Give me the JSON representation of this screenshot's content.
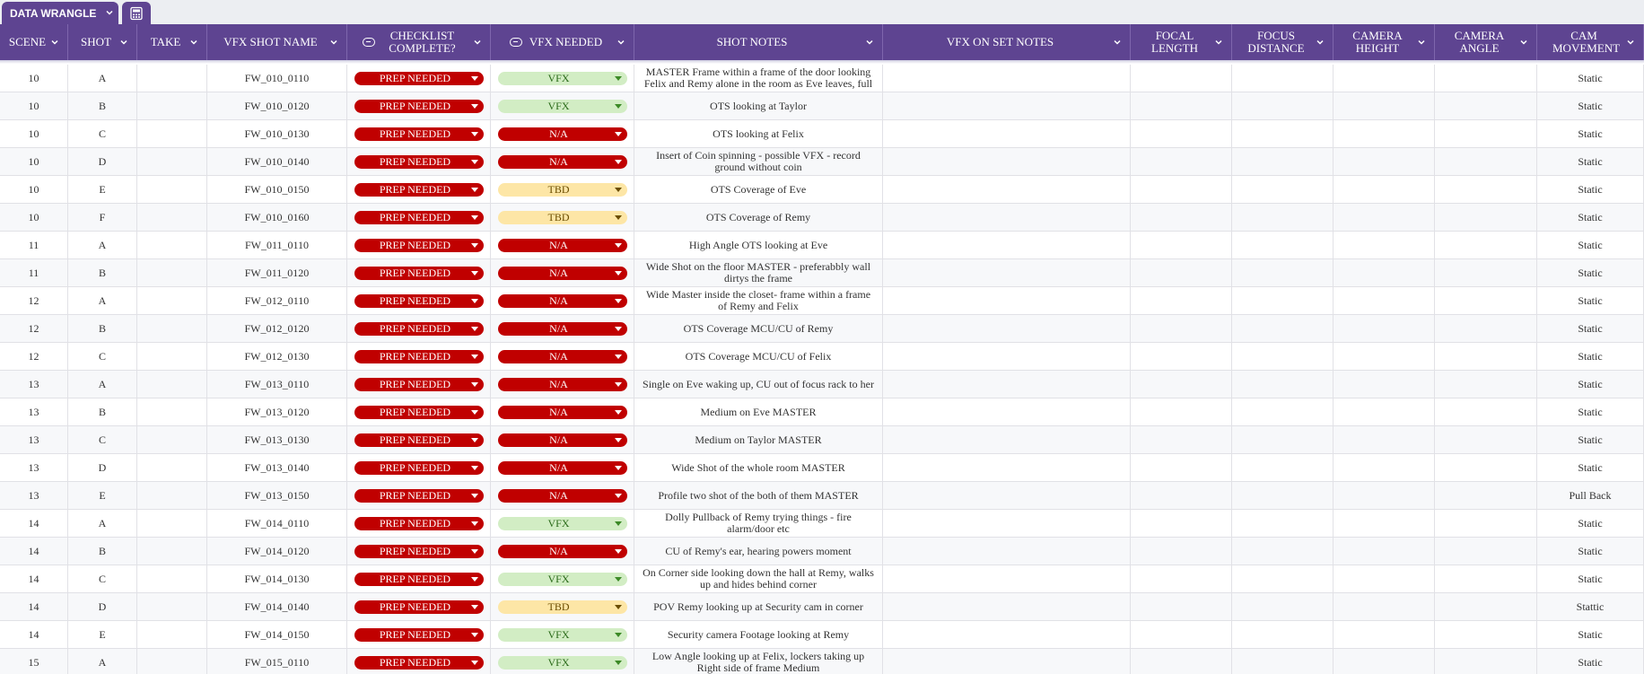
{
  "tabs": {
    "active_label": "DATA WRANGLE",
    "icon": "calculator-icon"
  },
  "colors": {
    "header_bg": "#5e4491",
    "prep_needed": "#c00000",
    "vfx": "#d2edc4",
    "na": "#c00000",
    "tbd": "#fde6a6"
  },
  "columns": {
    "scene": "SCENE",
    "shot": "SHOT",
    "take": "TAKE",
    "vfx_shot_name": "VFX SHOT NAME",
    "checklist_complete": "CHECKLIST COMPLETE?",
    "vfx_needed": "VFX NEEDED",
    "shot_notes": "SHOT NOTES",
    "vfx_on_set_notes": "VFX ON SET NOTES",
    "focal_length": "FOCAL LENGTH",
    "focus_distance": "FOCUS DISTANCE",
    "camera_height": "CAMERA HEIGHT",
    "camera_angle": "CAMERA ANGLE",
    "cam_movement": "CAM MOVEMENT"
  },
  "rows": [
    {
      "scene": "10",
      "shot": "A",
      "take": "",
      "name": "FW_010_0110",
      "checklist": "PREP NEEDED",
      "vfx": "VFX",
      "notes": "MASTER Frame within a frame of the door looking Felix and Remy alone in the room as Eve leaves, full",
      "onset": "",
      "focal": "",
      "fdist": "",
      "cheight": "",
      "cangle": "",
      "cam": "Static"
    },
    {
      "scene": "10",
      "shot": "B",
      "take": "",
      "name": "FW_010_0120",
      "checklist": "PREP NEEDED",
      "vfx": "VFX",
      "notes": "OTS looking at Taylor",
      "onset": "",
      "focal": "",
      "fdist": "",
      "cheight": "",
      "cangle": "",
      "cam": "Static"
    },
    {
      "scene": "10",
      "shot": "C",
      "take": "",
      "name": "FW_010_0130",
      "checklist": "PREP NEEDED",
      "vfx": "N/A",
      "notes": "OTS looking at Felix",
      "onset": "",
      "focal": "",
      "fdist": "",
      "cheight": "",
      "cangle": "",
      "cam": "Static"
    },
    {
      "scene": "10",
      "shot": "D",
      "take": "",
      "name": "FW_010_0140",
      "checklist": "PREP NEEDED",
      "vfx": "N/A",
      "notes": "Insert of Coin spinning - possible VFX - record ground without coin",
      "onset": "",
      "focal": "",
      "fdist": "",
      "cheight": "",
      "cangle": "",
      "cam": "Static"
    },
    {
      "scene": "10",
      "shot": "E",
      "take": "",
      "name": "FW_010_0150",
      "checklist": "PREP NEEDED",
      "vfx": "TBD",
      "notes": "OTS Coverage of Eve",
      "onset": "",
      "focal": "",
      "fdist": "",
      "cheight": "",
      "cangle": "",
      "cam": "Static"
    },
    {
      "scene": "10",
      "shot": "F",
      "take": "",
      "name": "FW_010_0160",
      "checklist": "PREP NEEDED",
      "vfx": "TBD",
      "notes": "OTS Coverage of Remy",
      "onset": "",
      "focal": "",
      "fdist": "",
      "cheight": "",
      "cangle": "",
      "cam": "Static"
    },
    {
      "scene": "11",
      "shot": "A",
      "take": "",
      "name": "FW_011_0110",
      "checklist": "PREP NEEDED",
      "vfx": "N/A",
      "notes": "High Angle OTS looking at Eve",
      "onset": "",
      "focal": "",
      "fdist": "",
      "cheight": "",
      "cangle": "",
      "cam": "Static"
    },
    {
      "scene": "11",
      "shot": "B",
      "take": "",
      "name": "FW_011_0120",
      "checklist": "PREP NEEDED",
      "vfx": "N/A",
      "notes": "Wide Shot on the floor MASTER - preferabbly wall dirtys the frame",
      "onset": "",
      "focal": "",
      "fdist": "",
      "cheight": "",
      "cangle": "",
      "cam": "Static"
    },
    {
      "scene": "12",
      "shot": "A",
      "take": "",
      "name": "FW_012_0110",
      "checklist": "PREP NEEDED",
      "vfx": "N/A",
      "notes": "Wide Master inside the closet- frame within a frame of Remy and Felix",
      "onset": "",
      "focal": "",
      "fdist": "",
      "cheight": "",
      "cangle": "",
      "cam": "Static"
    },
    {
      "scene": "12",
      "shot": "B",
      "take": "",
      "name": "FW_012_0120",
      "checklist": "PREP NEEDED",
      "vfx": "N/A",
      "notes": "OTS Coverage MCU/CU of Remy",
      "onset": "",
      "focal": "",
      "fdist": "",
      "cheight": "",
      "cangle": "",
      "cam": "Static"
    },
    {
      "scene": "12",
      "shot": "C",
      "take": "",
      "name": "FW_012_0130",
      "checklist": "PREP NEEDED",
      "vfx": "N/A",
      "notes": "OTS Coverage MCU/CU of Felix",
      "onset": "",
      "focal": "",
      "fdist": "",
      "cheight": "",
      "cangle": "",
      "cam": "Static"
    },
    {
      "scene": "13",
      "shot": "A",
      "take": "",
      "name": "FW_013_0110",
      "checklist": "PREP NEEDED",
      "vfx": "N/A",
      "notes": "Single on Eve waking up, CU out of focus rack to her",
      "onset": "",
      "focal": "",
      "fdist": "",
      "cheight": "",
      "cangle": "",
      "cam": "Static"
    },
    {
      "scene": "13",
      "shot": "B",
      "take": "",
      "name": "FW_013_0120",
      "checklist": "PREP NEEDED",
      "vfx": "N/A",
      "notes": "Medium on Eve MASTER",
      "onset": "",
      "focal": "",
      "fdist": "",
      "cheight": "",
      "cangle": "",
      "cam": "Static"
    },
    {
      "scene": "13",
      "shot": "C",
      "take": "",
      "name": "FW_013_0130",
      "checklist": "PREP NEEDED",
      "vfx": "N/A",
      "notes": "Medium on Taylor MASTER",
      "onset": "",
      "focal": "",
      "fdist": "",
      "cheight": "",
      "cangle": "",
      "cam": "Static"
    },
    {
      "scene": "13",
      "shot": "D",
      "take": "",
      "name": "FW_013_0140",
      "checklist": "PREP NEEDED",
      "vfx": "N/A",
      "notes": "Wide Shot of the whole room MASTER",
      "onset": "",
      "focal": "",
      "fdist": "",
      "cheight": "",
      "cangle": "",
      "cam": "Static"
    },
    {
      "scene": "13",
      "shot": "E",
      "take": "",
      "name": "FW_013_0150",
      "checklist": "PREP NEEDED",
      "vfx": "N/A",
      "notes": "Profile two shot of the both of them MASTER",
      "onset": "",
      "focal": "",
      "fdist": "",
      "cheight": "",
      "cangle": "",
      "cam": "Pull Back"
    },
    {
      "scene": "14",
      "shot": "A",
      "take": "",
      "name": "FW_014_0110",
      "checklist": "PREP NEEDED",
      "vfx": "VFX",
      "notes": "Dolly Pullback of Remy trying things - fire alarm/door etc",
      "onset": "",
      "focal": "",
      "fdist": "",
      "cheight": "",
      "cangle": "",
      "cam": "Static"
    },
    {
      "scene": "14",
      "shot": "B",
      "take": "",
      "name": "FW_014_0120",
      "checklist": "PREP NEEDED",
      "vfx": "N/A",
      "notes": "CU of Remy's ear, hearing powers moment",
      "onset": "",
      "focal": "",
      "fdist": "",
      "cheight": "",
      "cangle": "",
      "cam": "Static"
    },
    {
      "scene": "14",
      "shot": "C",
      "take": "",
      "name": "FW_014_0130",
      "checklist": "PREP NEEDED",
      "vfx": "VFX",
      "notes": "On Corner side looking down the hall at Remy, walks up and hides behind corner",
      "onset": "",
      "focal": "",
      "fdist": "",
      "cheight": "",
      "cangle": "",
      "cam": "Static"
    },
    {
      "scene": "14",
      "shot": "D",
      "take": "",
      "name": "FW_014_0140",
      "checklist": "PREP NEEDED",
      "vfx": "TBD",
      "notes": "POV Remy looking up at Security cam in corner",
      "onset": "",
      "focal": "",
      "fdist": "",
      "cheight": "",
      "cangle": "",
      "cam": "Stattic"
    },
    {
      "scene": "14",
      "shot": "E",
      "take": "",
      "name": "FW_014_0150",
      "checklist": "PREP NEEDED",
      "vfx": "VFX",
      "notes": "Security camera Footage looking at Remy",
      "onset": "",
      "focal": "",
      "fdist": "",
      "cheight": "",
      "cangle": "",
      "cam": "Static"
    },
    {
      "scene": "15",
      "shot": "A",
      "take": "",
      "name": "FW_015_0110",
      "checklist": "PREP NEEDED",
      "vfx": "VFX",
      "notes": "Low Angle looking up at Felix, lockers taking up Right side of frame Medium",
      "onset": "",
      "focal": "",
      "fdist": "",
      "cheight": "",
      "cangle": "",
      "cam": "Static"
    }
  ]
}
